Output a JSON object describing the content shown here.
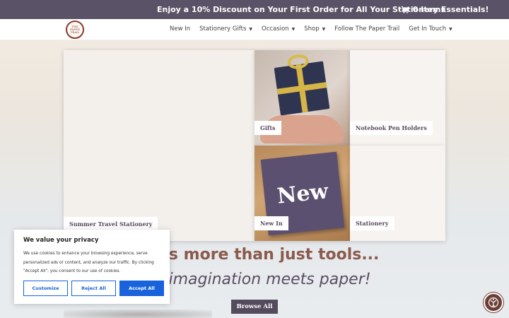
{
  "topbar": {
    "promo": "Enjoy a 10% Discount on Your First Order for All Your Stationery Essentials!",
    "cart_label": "0 Items",
    "cart_icon": "cart-icon"
  },
  "header": {
    "logo_text": "THE PAPER TRAIL",
    "nav": [
      {
        "label": "New In",
        "dropdown": false
      },
      {
        "label": "Stationery Gifts",
        "dropdown": true
      },
      {
        "label": "Occasion",
        "dropdown": true
      },
      {
        "label": "Shop",
        "dropdown": true
      },
      {
        "label": "Follow The Paper Trail",
        "dropdown": false
      },
      {
        "label": "Get In Touch",
        "dropdown": true
      }
    ]
  },
  "tiles": {
    "summer": "Summer Travel Stationery",
    "gifts": "Gifts",
    "notebook": "Notebook Pen Holders",
    "newin": "New In",
    "newin_note": "New",
    "stationery": "Stationery"
  },
  "hero": {
    "headline": "ery is more than just tools...",
    "subline": "ere imagination meets paper!",
    "browse_label": "Browse All"
  },
  "cookie": {
    "title": "We value your privacy",
    "body": "We use cookies to enhance your browsing experience, serve personalized ads or content, and analyze our traffic. By clicking \"Accept All\", you consent to our use of cookies.",
    "customize": "Customize",
    "reject": "Reject All",
    "accept": "Accept All"
  },
  "colors": {
    "topbar": "#5a5367",
    "accent_brown": "#8b5a4d",
    "purple": "#5a4c62",
    "cookie_blue": "#1863dc"
  }
}
